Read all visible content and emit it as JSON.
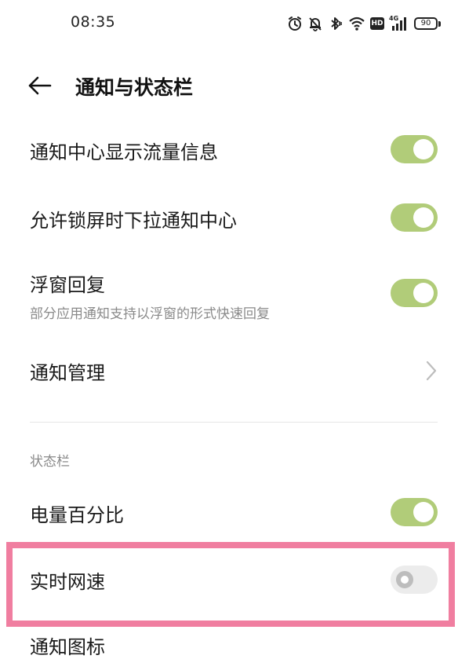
{
  "status_bar": {
    "time": "08:35",
    "battery_level": "90",
    "network_type": "4G",
    "hd_label": "HD",
    "icons": [
      "alarm-icon",
      "mute-icon",
      "bluetooth-icon",
      "wifi-icon",
      "hd-icon",
      "signal-icon",
      "battery-icon"
    ]
  },
  "header": {
    "title": "通知与状态栏",
    "back_icon": "arrow-left-icon"
  },
  "settings": {
    "notif_traffic": {
      "label": "通知中心显示流量信息",
      "enabled": true
    },
    "lock_pulldown": {
      "label": "允许锁屏时下拉通知中心",
      "enabled": true
    },
    "float_reply": {
      "label": "浮窗回复",
      "description": "部分应用通知支持以浮窗的形式快速回复",
      "enabled": true
    },
    "notif_manage": {
      "label": "通知管理",
      "icon": "chevron-right-icon"
    }
  },
  "status_section": {
    "header": "状态栏",
    "battery_percent": {
      "label": "电量百分比",
      "enabled": true
    },
    "realtime_speed": {
      "label": "实时网速",
      "enabled": false
    },
    "notif_icons": {
      "label": "通知图标"
    }
  },
  "colors": {
    "toggle_on": "#b1cc79",
    "toggle_off": "#ececec",
    "highlight": "#f07ea0",
    "secondary_text": "#8a8a8a"
  }
}
